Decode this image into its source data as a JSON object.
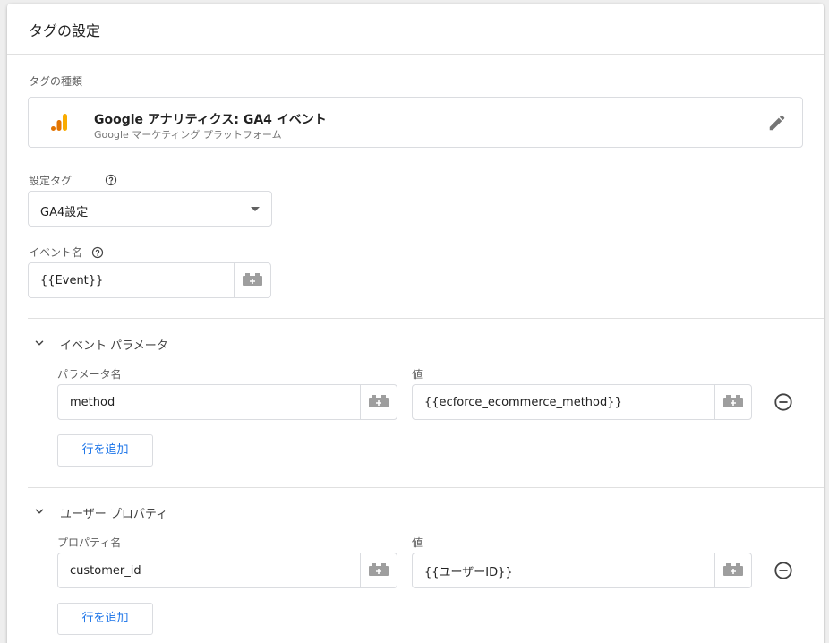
{
  "header": {
    "title": "タグの設定"
  },
  "tag_type": {
    "label": "タグの種類",
    "name": "Google アナリティクス: GA4 イベント",
    "vendor": "Google マーケティング プラットフォーム"
  },
  "config_tag": {
    "label": "設定タグ",
    "value": "GA4設定"
  },
  "event_name": {
    "label": "イベント名",
    "value": "{{Event}}"
  },
  "event_params": {
    "title": "イベント パラメータ",
    "name_header": "パラメータ名",
    "value_header": "値",
    "rows": [
      {
        "name": "method",
        "value": "{{ecforce_ecommerce_method}}"
      }
    ],
    "add_row_label": "行を追加"
  },
  "user_props": {
    "title": "ユーザー プロパティ",
    "name_header": "プロパティ名",
    "value_header": "値",
    "rows": [
      {
        "name": "customer_id",
        "value": "{{ユーザーID}}"
      }
    ],
    "add_row_label": "行を追加"
  },
  "colors": {
    "accent": "#1a73e8",
    "ga_orange": "#f9ab00",
    "ga_dark_orange": "#e37400"
  },
  "icons": {
    "logo": "google-analytics-icon",
    "edit": "pencil-icon",
    "help": "help-circle-icon",
    "variable": "lego-brick-icon",
    "remove": "minus-circle-icon",
    "collapse": "chevron-down-icon"
  }
}
